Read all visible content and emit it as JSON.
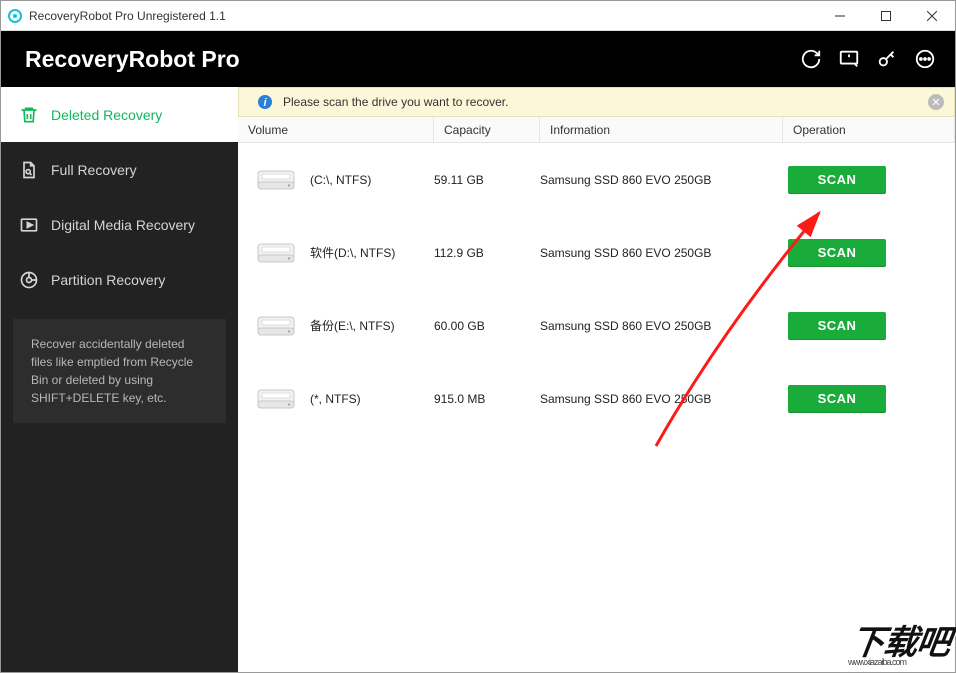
{
  "window": {
    "title": "RecoveryRobot Pro Unregistered 1.1"
  },
  "brand": "RecoveryRobot Pro",
  "sidebar": {
    "items": [
      {
        "label": "Deleted Recovery"
      },
      {
        "label": "Full Recovery"
      },
      {
        "label": "Digital Media Recovery"
      },
      {
        "label": "Partition Recovery"
      }
    ],
    "description": "Recover accidentally deleted files like emptied from Recycle Bin or deleted by using SHIFT+DELETE key, etc."
  },
  "infobar": {
    "message": "Please scan the drive you want to recover."
  },
  "table": {
    "headers": {
      "volume": "Volume",
      "capacity": "Capacity",
      "information": "Information",
      "operation": "Operation"
    },
    "scan_label": "SCAN",
    "rows": [
      {
        "volume": "(C:\\, NTFS)",
        "capacity": "59.11 GB",
        "information": "Samsung SSD 860 EVO 250GB"
      },
      {
        "volume": "软件(D:\\, NTFS)",
        "capacity": "112.9 GB",
        "information": "Samsung SSD 860 EVO 250GB"
      },
      {
        "volume": "备份(E:\\, NTFS)",
        "capacity": "60.00 GB",
        "information": "Samsung SSD 860 EVO 250GB"
      },
      {
        "volume": "(*, NTFS)",
        "capacity": "915.0 MB",
        "information": "Samsung SSD 860 EVO 250GB"
      }
    ]
  },
  "watermark": {
    "main": "下载吧",
    "sub": "www.xiazaiba.com"
  }
}
